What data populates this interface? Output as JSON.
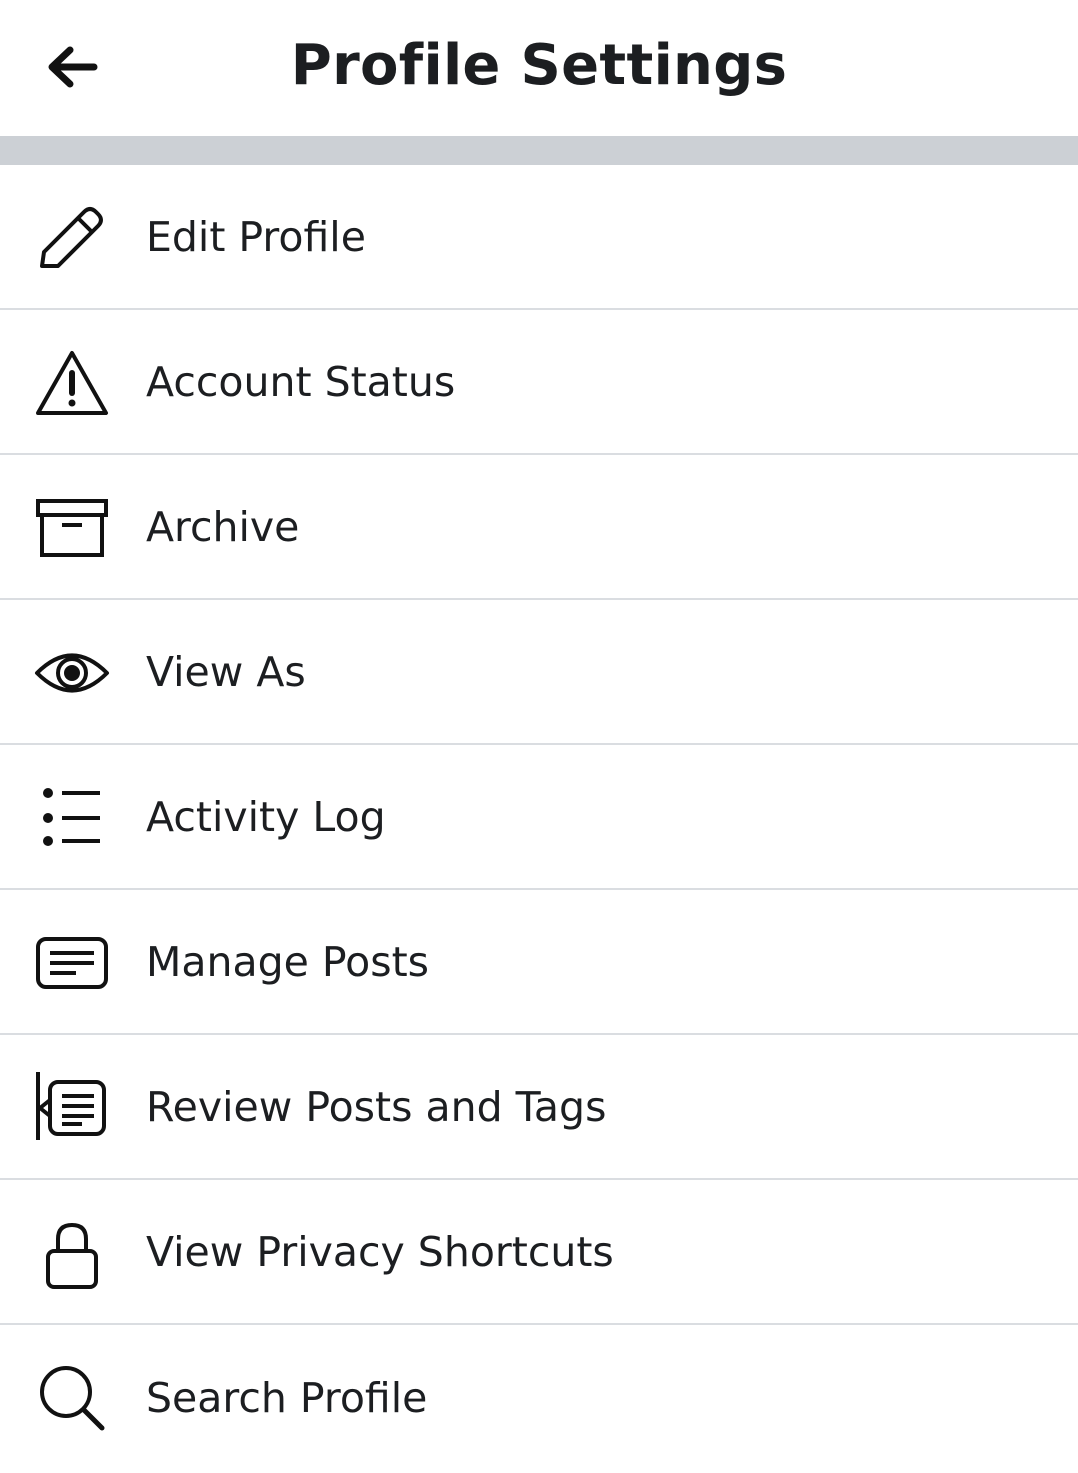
{
  "header": {
    "title": "Profile Settings",
    "back_icon": "arrow-left-icon"
  },
  "menu": {
    "items": [
      {
        "label": "Edit Profile",
        "icon": "pencil-icon"
      },
      {
        "label": "Account Status",
        "icon": "warning-triangle-icon"
      },
      {
        "label": "Archive",
        "icon": "archive-box-icon"
      },
      {
        "label": "View As",
        "icon": "eye-icon"
      },
      {
        "label": "Activity Log",
        "icon": "list-icon"
      },
      {
        "label": "Manage Posts",
        "icon": "posts-icon"
      },
      {
        "label": "Review Posts and Tags",
        "icon": "review-posts-icon"
      },
      {
        "label": "View Privacy Shortcuts",
        "icon": "lock-icon"
      },
      {
        "label": "Search Profile",
        "icon": "search-icon"
      }
    ]
  },
  "colors": {
    "text": "#1c1e21",
    "divider": "#dadde1",
    "band": "#ccd0d5",
    "background": "#ffffff"
  }
}
